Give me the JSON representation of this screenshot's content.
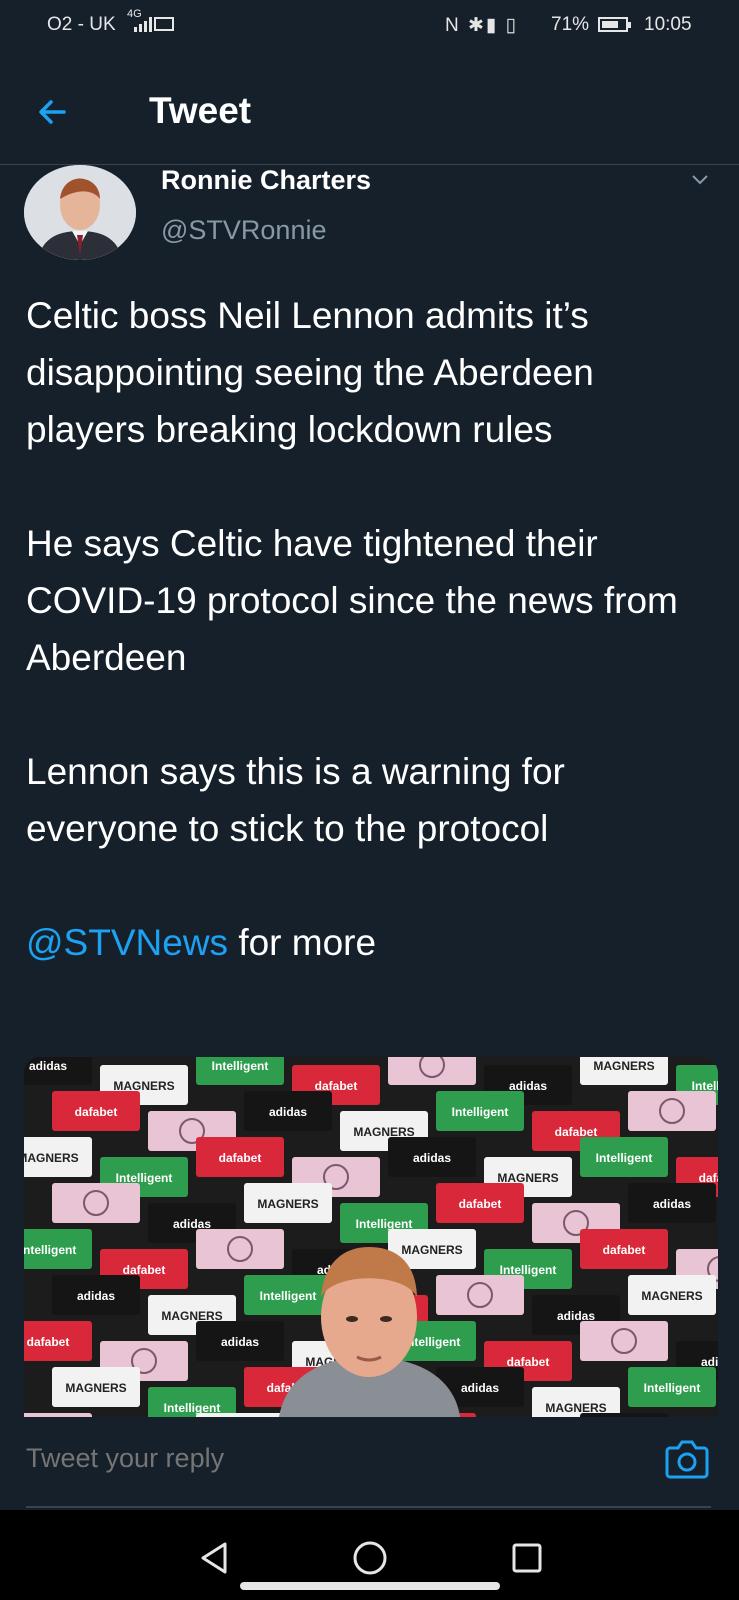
{
  "status_bar": {
    "carrier": "O2 - UK",
    "network": "4G",
    "sys_icons": "N ✱▮ ▯",
    "battery_pct": "71%",
    "battery_level": 0.71,
    "time": "10:05"
  },
  "header": {
    "title": "Tweet"
  },
  "tweet": {
    "author_name": "Ronnie Charters",
    "author_handle": "@STVRonnie",
    "paragraphs": [
      "Celtic boss Neil Lennon admits it’s disappointing seeing the Aberdeen players breaking lockdown rules",
      "He says Celtic have tightened their COVID-19 protocol since the news from Aberdeen",
      "Lennon says this is a warning for everyone to stick to the protocol"
    ],
    "mention": "@STVNews",
    "mention_suffix": " for more"
  },
  "media": {
    "sponsor_labels": [
      "adidas",
      "dafabet",
      "MAGNERS",
      "Intelligent"
    ]
  },
  "reply": {
    "placeholder": "Tweet your reply"
  },
  "colors": {
    "background": "#15202b",
    "accent": "#1da1f2",
    "muted": "#8899a6"
  }
}
